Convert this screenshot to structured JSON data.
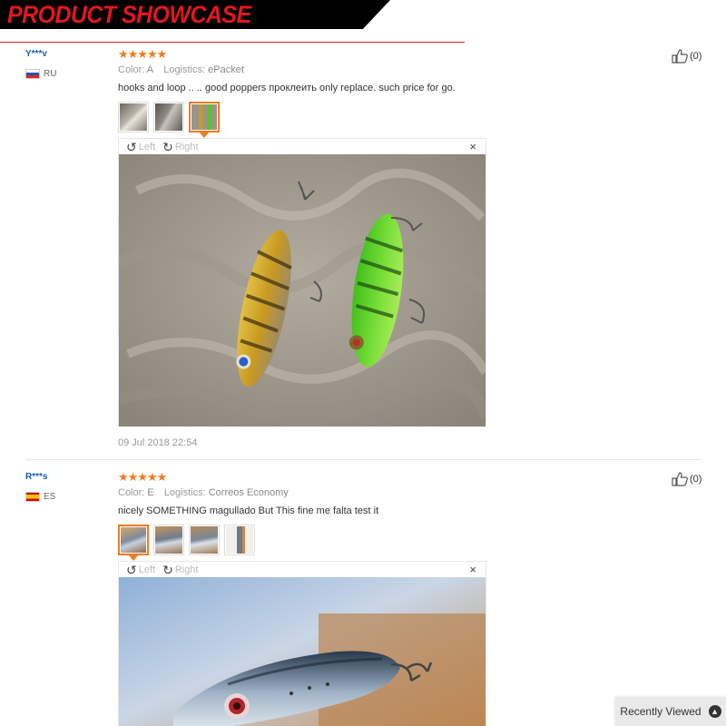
{
  "banner": {
    "title": "PRODUCT SHOWCASE"
  },
  "viewer_controls": {
    "left": "Left",
    "right": "Right",
    "close": "×"
  },
  "reviews": [
    {
      "user": "Y***v",
      "country": "RU",
      "stars": "★★★★★",
      "color_label": "Color:",
      "color": "A",
      "logistics_label": "Logistics:",
      "logistics": "ePacket",
      "comment": "hooks and loop .. .. good poppers проклеить only replace. such price for go.",
      "helpful": "(0)",
      "date": "09 Jul 2018 22:54"
    },
    {
      "user": "R***s",
      "country": "ES",
      "stars": "★★★★★",
      "color_label": "Color:",
      "color": "E",
      "logistics_label": "Logistics:",
      "logistics": "Correos Economy",
      "comment": "nicely SOMETHING magullado But This fine me falta test it",
      "helpful": "(0)"
    }
  ],
  "recently_viewed": {
    "label": "Recently Viewed",
    "icon": "chevron-up-icon"
  },
  "colors": {
    "accent": "#f07b21",
    "brand_red": "#e0181e",
    "link_blue": "#1a5eb4"
  }
}
